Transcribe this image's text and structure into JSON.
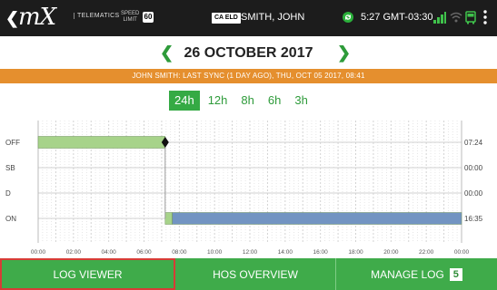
{
  "topbar": {
    "back_icon": "back-chevron-icon",
    "logo_text": "mX",
    "telematics_label": "TELEMATICS",
    "speed_label_line1": "SPEED",
    "speed_label_line2": "LIMIT",
    "speed_limit": "60",
    "region_badge": "CA ELD",
    "driver_name": "SMITH, JOHN",
    "time": "5:27 GMT-03:30",
    "icons": [
      "sync-icon",
      "signal-icon",
      "wifi-icon",
      "bus-icon",
      "menu-icon"
    ]
  },
  "date_nav": {
    "prev_icon": "chevron-left-icon",
    "date": "26 OCTOBER 2017",
    "next_icon": "chevron-right-icon"
  },
  "sync_banner": "JOHN SMITH: LAST SYNC (1 DAY AGO), THU, OCT 05 2017, 08:41",
  "range_tabs": [
    {
      "label": "24h",
      "active": true
    },
    {
      "label": "12h",
      "active": false
    },
    {
      "label": "8h",
      "active": false
    },
    {
      "label": "6h",
      "active": false
    },
    {
      "label": "3h",
      "active": false
    }
  ],
  "chart_data": {
    "type": "gantt",
    "rows": [
      "OFF",
      "SB",
      "D",
      "ON"
    ],
    "row_totals": [
      "07:24",
      "00:00",
      "00:00",
      "16:35"
    ],
    "x_ticks": [
      "00:00",
      "02:00",
      "04:00",
      "06:00",
      "08:00",
      "10:00",
      "12:00",
      "14:00",
      "16:00",
      "18:00",
      "20:00",
      "22:00",
      "00:00"
    ],
    "x_range_hours": [
      0,
      24
    ],
    "segments": [
      {
        "status": "OFF",
        "start_hour": 0,
        "end_hour": 7.2,
        "color": "#a7d38a"
      },
      {
        "status": "ON",
        "start_hour": 7.2,
        "end_hour": 7.6,
        "color": "#a7d38a"
      },
      {
        "status": "ON",
        "start_hour": 7.6,
        "end_hour": 24,
        "color": "#7294c2"
      }
    ],
    "marker_hour": 7.2
  },
  "bottom_nav": {
    "log_viewer": "LOG VIEWER",
    "hos_overview": "HOS OVERVIEW",
    "manage_log": "MANAGE LOG",
    "manage_log_count": "5"
  },
  "colors": {
    "accent_green": "#3fab4a",
    "banner_orange": "#e58f2e",
    "selected_outline": "#d73c36",
    "off_duty": "#a7d38a",
    "on_duty": "#7294c2"
  }
}
